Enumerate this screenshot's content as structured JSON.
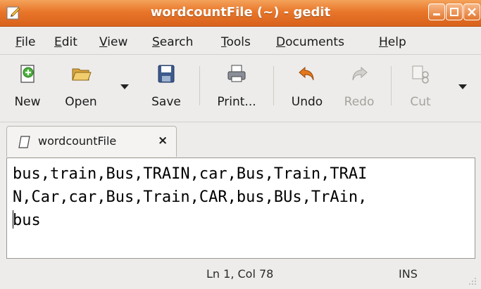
{
  "window": {
    "title": "wordcountFile (~) - gedit",
    "accent": "#e8762a"
  },
  "menubar": {
    "items": [
      {
        "label_rest": "ile",
        "mnemonic": "F"
      },
      {
        "label_rest": "dit",
        "mnemonic": "E"
      },
      {
        "label_rest": "iew",
        "mnemonic": "V"
      },
      {
        "label_rest": "earch",
        "mnemonic": "S"
      },
      {
        "label_rest": "ools",
        "mnemonic": "T"
      },
      {
        "label_rest": "ocuments",
        "mnemonic": "D"
      },
      {
        "label_rest": "elp",
        "mnemonic": "H"
      }
    ]
  },
  "toolbar": {
    "new_label": "New",
    "open_label": "Open",
    "save_label": "Save",
    "print_label": "Print...",
    "undo_label": "Undo",
    "redo_label": "Redo",
    "cut_label": "Cut"
  },
  "tab": {
    "label": "wordcountFile",
    "close": "×"
  },
  "editor": {
    "line1": "bus,train,Bus,TRAIN,car,Bus,Train,TRAI",
    "line2": "N,Car,car,Bus,Train,CAR,bus,BUs,TrAin,",
    "line3": "bus"
  },
  "statusbar": {
    "position": "Ln 1, Col 78",
    "mode": "INS"
  }
}
